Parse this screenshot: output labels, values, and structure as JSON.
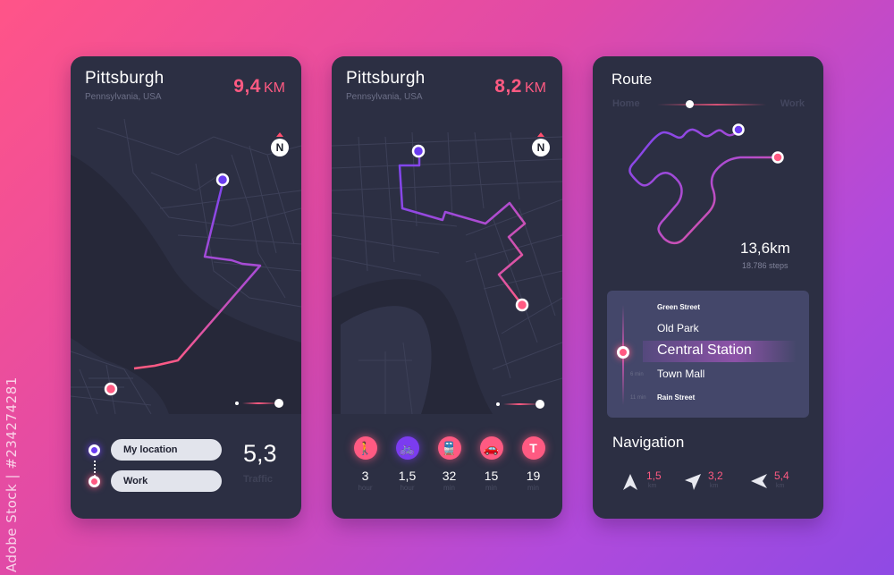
{
  "watermark": {
    "stock_id": "Adobe Stock | #234274281"
  },
  "colors": {
    "accent_pink": "#ff5a82",
    "accent_purple": "#6a3cf0",
    "panel_bg": "#2c2f43"
  },
  "panel1": {
    "city": "Pittsburgh",
    "region": "Pennsylvania, USA",
    "distance_value": "9,4",
    "distance_unit": "KM",
    "compass": "N",
    "locations": [
      {
        "label": "My location",
        "icon": "origin-dot"
      },
      {
        "label": "Work",
        "icon": "destination-dot"
      }
    ],
    "traffic_value": "5,3",
    "traffic_label": "Traffic"
  },
  "panel2": {
    "city": "Pittsburgh",
    "region": "Pennsylvania, USA",
    "distance_value": "8,2",
    "distance_unit": "KM",
    "compass": "N",
    "modes": [
      {
        "icon": "walk-icon",
        "glyph": "🚶",
        "value": "3",
        "unit": "hour",
        "active": false
      },
      {
        "icon": "bike-icon",
        "glyph": "🚲",
        "value": "1,5",
        "unit": "hour",
        "active": true
      },
      {
        "icon": "tram-icon",
        "glyph": "🚆",
        "value": "32",
        "unit": "min",
        "active": false
      },
      {
        "icon": "car-icon",
        "glyph": "🚗",
        "value": "15",
        "unit": "min",
        "active": false
      },
      {
        "icon": "taxi-icon",
        "glyph": "T",
        "value": "19",
        "unit": "min",
        "active": false
      }
    ]
  },
  "panel3": {
    "title": "Route",
    "from_label": "Home",
    "to_label": "Work",
    "total_distance": "13,6km",
    "steps": "18.786 steps",
    "stops": [
      {
        "name": "Green Street",
        "time": ""
      },
      {
        "name": "Old Park",
        "time": ""
      },
      {
        "name": "Central Station",
        "time": "",
        "current": true
      },
      {
        "name": "Town Mall",
        "time": "6 min"
      },
      {
        "name": "Rain Street",
        "time": "11 min"
      }
    ],
    "navigation_title": "Navigation",
    "navigation": [
      {
        "icon": "arrow-straight-icon",
        "value": "1,5",
        "unit": "km"
      },
      {
        "icon": "arrow-right-icon",
        "value": "3,2",
        "unit": "km"
      },
      {
        "icon": "arrow-left-icon",
        "value": "5,4",
        "unit": "km"
      }
    ]
  }
}
